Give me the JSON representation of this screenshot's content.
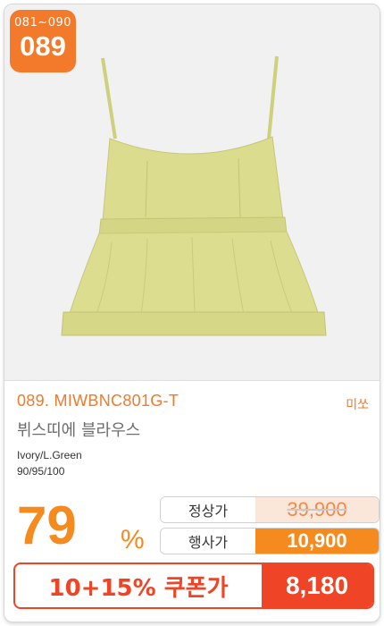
{
  "badge": {
    "range": "081~090",
    "number": "089"
  },
  "product": {
    "code": "089. MIWBNC801G-T",
    "brand": "미쏘",
    "name": "뷔스띠에 블라우스",
    "color_options": "Ivory/L.Green",
    "sizes": "90/95/100",
    "image": "yellow-green-bustier-blouse"
  },
  "pricing": {
    "discount": "79",
    "percent_sign": "%",
    "normal_label": "정상가",
    "normal_price": "39,900",
    "event_label": "행사가",
    "event_price": "10,900",
    "coupon_label": "10+15% 쿠폰가",
    "coupon_price": "8,180"
  },
  "colors": {
    "accent_orange": "#f58a1f",
    "coupon_red": "#ef4526",
    "product_color": "#d8d98a"
  }
}
